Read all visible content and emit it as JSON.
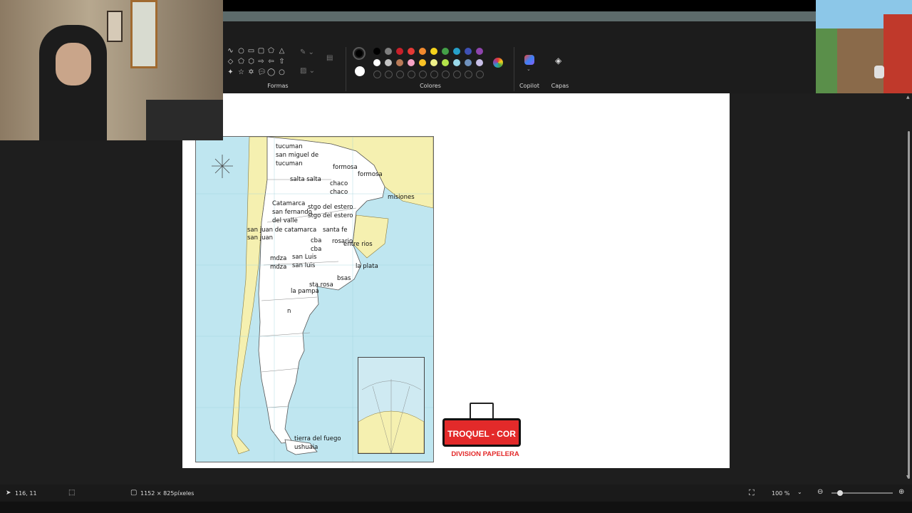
{
  "ribbon": {
    "shapes_label": "Formas",
    "colors_label": "Colores",
    "copilot_label": "Copilot",
    "layers_label": "Capas",
    "primary_color": "#000000",
    "secondary_color": "#ffffff",
    "palette_row1": [
      "#000000",
      "#7f7f7f",
      "#c8202a",
      "#e53935",
      "#f28a2e",
      "#f4d21b",
      "#43a047",
      "#26a0c9",
      "#3f51b5",
      "#8e44ad"
    ],
    "palette_row2": [
      "#ffffff",
      "#c3c3c3",
      "#b97a57",
      "#f6a3c5",
      "#f9c226",
      "#eef08a",
      "#b4e34a",
      "#99d9ea",
      "#7092be",
      "#c8bfe7"
    ]
  },
  "map": {
    "labels": [
      {
        "text": "tucuman"
      },
      {
        "text": "san miguel de"
      },
      {
        "text": "tucuman"
      },
      {
        "text": "formosa"
      },
      {
        "text": "formosa"
      },
      {
        "text": "salta salta"
      },
      {
        "text": "chaco"
      },
      {
        "text": "chaco"
      },
      {
        "text": "misiones"
      },
      {
        "text": "Catamarca"
      },
      {
        "text": "san fernando"
      },
      {
        "text": "del valle"
      },
      {
        "text": "stgo del estero"
      },
      {
        "text": "stgo del estero"
      },
      {
        "text": "san juan de catamarca"
      },
      {
        "text": "san juan"
      },
      {
        "text": "santa fe"
      },
      {
        "text": "cba"
      },
      {
        "text": "cba"
      },
      {
        "text": "rosario"
      },
      {
        "text": "entre rios"
      },
      {
        "text": "mdza"
      },
      {
        "text": "mdza"
      },
      {
        "text": "san Luis"
      },
      {
        "text": "san luis"
      },
      {
        "text": "la plata"
      },
      {
        "text": "bsas"
      },
      {
        "text": "sta rosa"
      },
      {
        "text": "la pampa"
      },
      {
        "text": "n"
      },
      {
        "text": "tierra del fuego"
      },
      {
        "text": "ushuaia"
      }
    ]
  },
  "logo": {
    "brand": "TROQUEL - COR",
    "subtitle": "DIVISION PAPELERA"
  },
  "statusbar": {
    "cursor_pos": "116, 11",
    "dimensions": "1152 × 825píxeles",
    "zoom": "100 %"
  }
}
